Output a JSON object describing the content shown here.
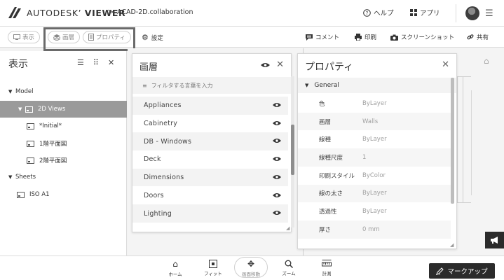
{
  "header": {
    "brand_light": "AUTODESK",
    "brand_bold": "VIEWER",
    "breadcrumb_separator": ">",
    "filename": "ACAD-2D.collaboration",
    "help_label": "ヘルプ",
    "apps_label": "アプリ"
  },
  "toolbar": {
    "view_label": "表示",
    "layers_label": "画層",
    "properties_label": "プロパティ",
    "settings_label": "設定",
    "comment_label": "コメント",
    "print_label": "印刷",
    "screenshot_label": "スクリーンショット",
    "share_label": "共有"
  },
  "left_panel": {
    "title": "表示",
    "tree": [
      {
        "label": "Model",
        "level": 0,
        "caret": "▼"
      },
      {
        "label": "2D Views",
        "level": 1,
        "caret": "▼",
        "selected": true
      },
      {
        "label": "*Initial*",
        "level": 2
      },
      {
        "label": "1階平面図",
        "level": 2
      },
      {
        "label": "2階平面図",
        "level": 2
      },
      {
        "label": "Sheets",
        "level": 0,
        "caret": "▼"
      },
      {
        "label": "ISO A1",
        "level": 1
      }
    ]
  },
  "layers_panel": {
    "title": "画層",
    "filter_placeholder": "フィルタする言葉を入力",
    "layers": [
      "Appliances",
      "Cabinetry",
      "DB - Windows",
      "Deck",
      "Dimensions",
      "Doors",
      "Lighting"
    ]
  },
  "properties_panel": {
    "title": "プロパティ",
    "section": "General",
    "rows": [
      {
        "label": "色",
        "value": "ByLayer"
      },
      {
        "label": "画層",
        "value": "Walls"
      },
      {
        "label": "線種",
        "value": "ByLayer"
      },
      {
        "label": "線種尺度",
        "value": "1"
      },
      {
        "label": "印刷スタイル",
        "value": "ByColor"
      },
      {
        "label": "線の太さ",
        "value": "ByLayer"
      },
      {
        "label": "透過性",
        "value": "ByLayer"
      },
      {
        "label": "厚さ",
        "value": "0 mm"
      }
    ]
  },
  "bottom_bar": {
    "home_label": "ホーム",
    "fit_label": "フィット",
    "pan_label": "画面移動",
    "zoom_label": "ズーム",
    "measure_label": "計測",
    "markup_label": "マークアップ"
  },
  "colors": {
    "selection": "#9a9a9a",
    "dark_button": "#2b2b2b",
    "panel_bg": "#ffffff",
    "canvas_bg": "#f4f4f4"
  }
}
